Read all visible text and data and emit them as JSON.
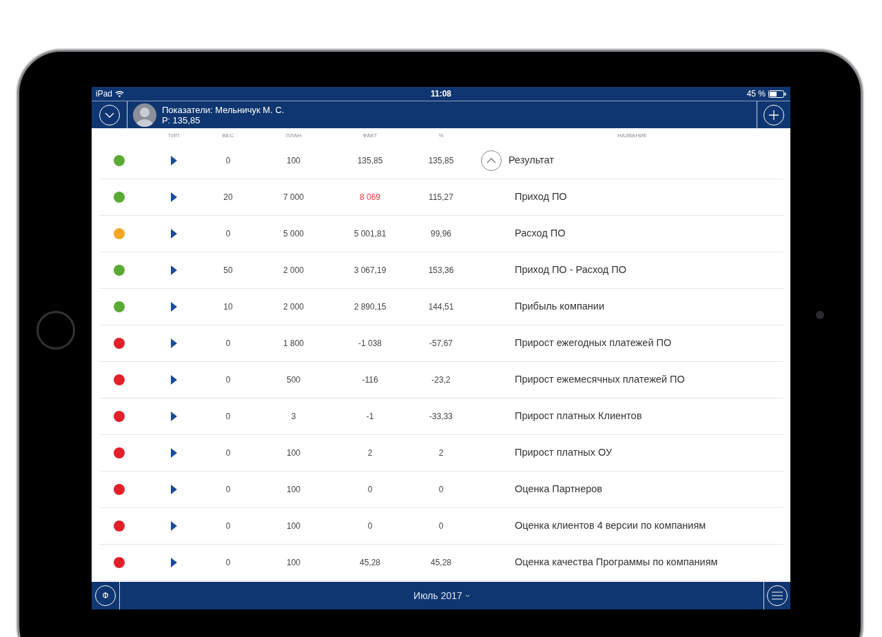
{
  "status_bar": {
    "device": "iPad",
    "time": "11:08",
    "battery": "45 %"
  },
  "header": {
    "title": "Показатели: Мельничук М. С.",
    "subtitle": "Р: 135,85"
  },
  "columns": [
    "ТИП",
    "ВЕС",
    "ПЛАН",
    "ФАКТ",
    "%",
    "НАЗВАНИЕ"
  ],
  "rows": [
    {
      "color": "#5aaa33",
      "weight": "0",
      "plan": "100",
      "fact": "135,85",
      "fact_flagged": false,
      "percent": "135,85",
      "name": "Результат",
      "expanded": true,
      "children": [
        {
          "color": "#5aaa33",
          "weight": "20",
          "plan": "7 000",
          "fact": "8 069",
          "fact_flagged": true,
          "percent": "115,27",
          "name": "Приход ПО"
        },
        {
          "color": "#f5a623",
          "weight": "0",
          "plan": "5 000",
          "fact": "5 001,81",
          "fact_flagged": false,
          "percent": "99,96",
          "name": "Расход ПО"
        },
        {
          "color": "#5aaa33",
          "weight": "50",
          "plan": "2 000",
          "fact": "3 067,19",
          "fact_flagged": false,
          "percent": "153,36",
          "name": "Приход ПО - Расход ПО"
        },
        {
          "color": "#5aaa33",
          "weight": "10",
          "plan": "2 000",
          "fact": "2 890,15",
          "fact_flagged": false,
          "percent": "144,51",
          "name": "Прибыль компании"
        },
        {
          "color": "#e3202a",
          "weight": "0",
          "plan": "1 800",
          "fact": "-1 038",
          "fact_flagged": false,
          "percent": "-57,67",
          "name": "Прирост ежегодных платежей ПО"
        },
        {
          "color": "#e3202a",
          "weight": "0",
          "plan": "500",
          "fact": "-116",
          "fact_flagged": false,
          "percent": "-23,2",
          "name": "Прирост ежемесячных платежей ПО"
        },
        {
          "color": "#e3202a",
          "weight": "0",
          "plan": "3",
          "fact": "-1",
          "fact_flagged": false,
          "percent": "-33,33",
          "name": "Прирост платных Клиентов"
        },
        {
          "color": "#e3202a",
          "weight": "0",
          "plan": "100",
          "fact": "2",
          "fact_flagged": false,
          "percent": "2",
          "name": "Прирост платных ОУ"
        },
        {
          "color": "#e3202a",
          "weight": "0",
          "plan": "100",
          "fact": "0",
          "fact_flagged": false,
          "percent": "0",
          "name": "Оценка Партнеров"
        },
        {
          "color": "#e3202a",
          "weight": "0",
          "plan": "100",
          "fact": "0",
          "fact_flagged": false,
          "percent": "0",
          "name": "Оценка клиентов 4 версии по компаниям"
        },
        {
          "color": "#e3202a",
          "weight": "0",
          "plan": "100",
          "fact": "45,28",
          "fact_flagged": false,
          "percent": "45,28",
          "name": "Оценка качества Программы по компаниям"
        }
      ]
    }
  ],
  "footer": {
    "left_button": "Ф",
    "period": "Июль 2017"
  }
}
